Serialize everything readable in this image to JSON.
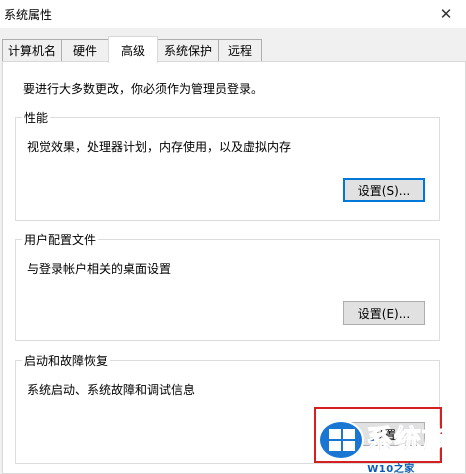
{
  "window": {
    "title": "系统属性",
    "close_glyph": "✕"
  },
  "tabs": [
    {
      "label": "计算机名"
    },
    {
      "label": "硬件"
    },
    {
      "label": "高级",
      "active": true
    },
    {
      "label": "系统保护"
    },
    {
      "label": "远程"
    }
  ],
  "notice": "要进行大多数更改，你必须作为管理员登录。",
  "groups": {
    "performance": {
      "title": "性能",
      "description": "视觉效果，处理器计划，内存使用，以及虚拟内存",
      "button": "设置(S)..."
    },
    "user_profiles": {
      "title": "用户配置文件",
      "description": "与登录帐户相关的桌面设置",
      "button": "设置(E)..."
    },
    "startup_recovery": {
      "title": "启动和故障恢复",
      "description": "系统启动、系统故障和调试信息",
      "button": "设置"
    }
  },
  "watermark": {
    "title": "系统族",
    "url": "W10之家 WWW.W10ZJ.COM"
  },
  "colors": {
    "accent": "#0078d7",
    "highlight": "#d42020",
    "watermark": "#0b5bb5"
  }
}
